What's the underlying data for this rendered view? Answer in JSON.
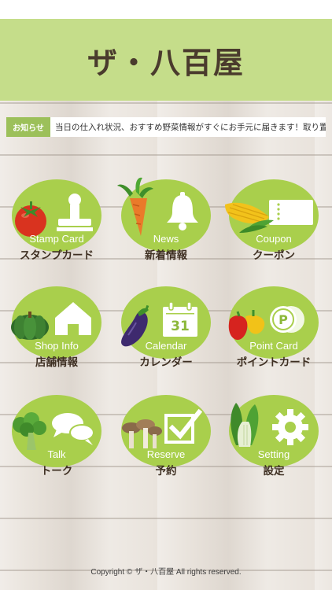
{
  "header": {
    "title": "ザ・八百屋"
  },
  "notice": {
    "label": "お知らせ",
    "text": "当日の仕入れ状況、おすすめ野菜情報がすぐにお手元に届きます！取り置き"
  },
  "menu": [
    {
      "en": "Stamp Card",
      "ja": "スタンプカード",
      "icon": "stamp-icon",
      "veg": "tomato-icon"
    },
    {
      "en": "News",
      "ja": "新着情報",
      "icon": "bell-icon",
      "veg": "carrot-icon"
    },
    {
      "en": "Coupon",
      "ja": "クーポン",
      "icon": "ticket-icon",
      "veg": "corn-icon"
    },
    {
      "en": "Shop Info",
      "ja": "店舗情報",
      "icon": "house-icon",
      "veg": "pumpkin-icon"
    },
    {
      "en": "Calendar",
      "ja": "カレンダー",
      "icon": "calendar-icon",
      "veg": "eggplant-icon",
      "calendar_day": "31"
    },
    {
      "en": "Point Card",
      "ja": "ポイントカード",
      "icon": "point-coin-icon",
      "veg": "bell-pepper-icon",
      "coin_letter": "P"
    },
    {
      "en": "Talk",
      "ja": "トーク",
      "icon": "chat-bubbles-icon",
      "veg": "broccoli-icon"
    },
    {
      "en": "Reserve",
      "ja": "予約",
      "icon": "checkbox-icon",
      "veg": "mushroom-icon"
    },
    {
      "en": "Setting",
      "ja": "設定",
      "icon": "gear-icon",
      "veg": "bok-choy-icon"
    }
  ],
  "footer": {
    "copyright": "Copyright © ザ・八百屋 All rights reserved."
  },
  "colors": {
    "header_bg": "#c5dd8a",
    "circle_green": "#a9cf4c",
    "notice_label_bg": "#9cc05a",
    "title_brown": "#4a3b2d"
  }
}
